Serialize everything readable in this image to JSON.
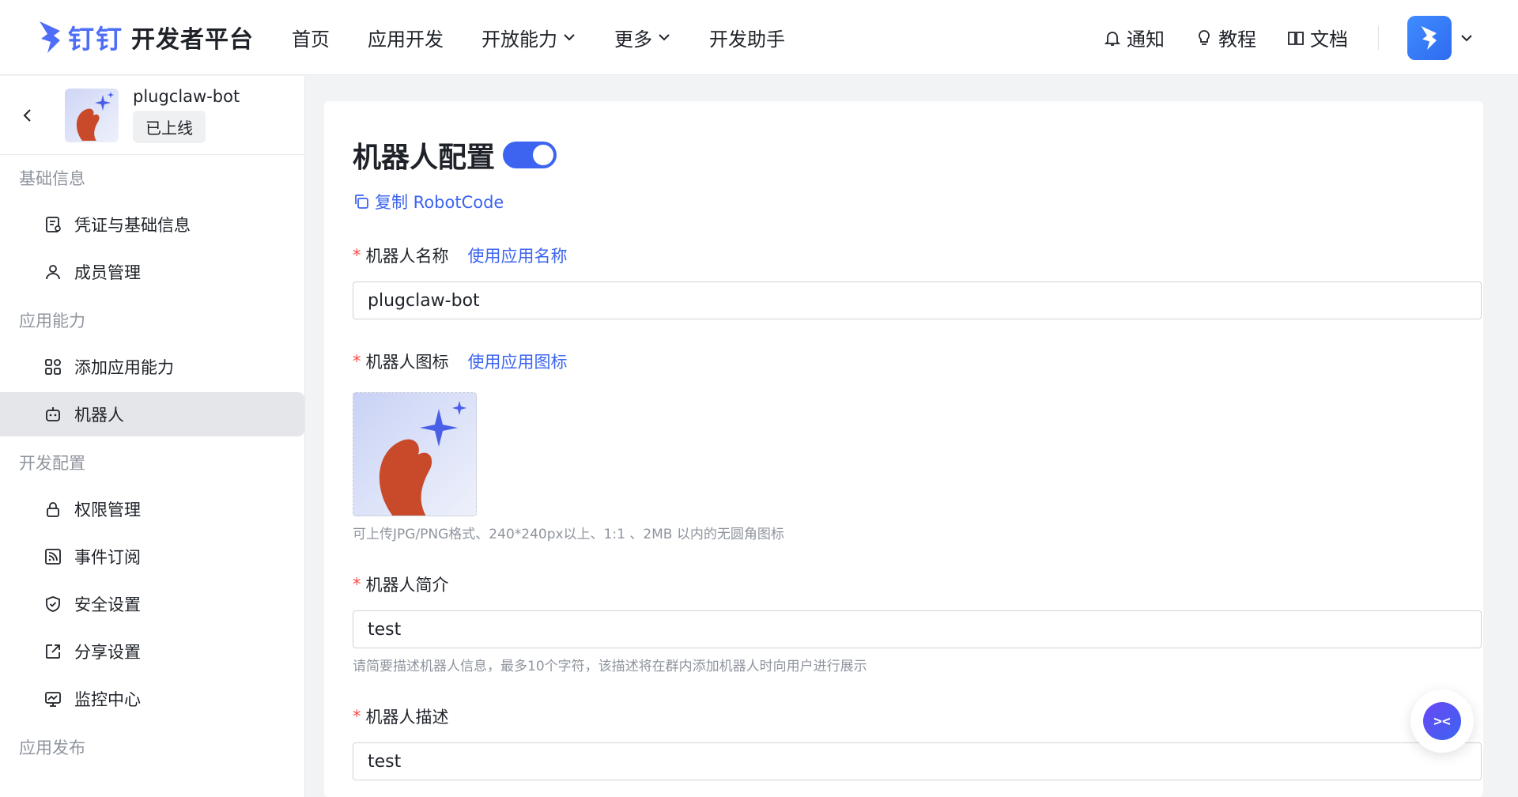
{
  "header": {
    "logo_brand": "钉钉",
    "logo_text": "开发者平台",
    "nav": [
      {
        "label": "首页",
        "has_dropdown": false
      },
      {
        "label": "应用开发",
        "has_dropdown": false
      },
      {
        "label": "开放能力",
        "has_dropdown": true
      },
      {
        "label": "更多",
        "has_dropdown": true
      },
      {
        "label": "开发助手",
        "has_dropdown": false
      }
    ],
    "tools": {
      "notify": "通知",
      "tutorial": "教程",
      "docs": "文档"
    }
  },
  "sidebar": {
    "app_name": "plugclaw-bot",
    "app_status": "已上线",
    "groups": [
      {
        "title": "基础信息",
        "items": [
          {
            "label": "凭证与基础信息",
            "icon": "credential-icon"
          },
          {
            "label": "成员管理",
            "icon": "user-icon"
          }
        ]
      },
      {
        "title": "应用能力",
        "items": [
          {
            "label": "添加应用能力",
            "icon": "grid-add-icon"
          },
          {
            "label": "机器人",
            "icon": "robot-icon",
            "active": true
          }
        ]
      },
      {
        "title": "开发配置",
        "items": [
          {
            "label": "权限管理",
            "icon": "lock-icon"
          },
          {
            "label": "事件订阅",
            "icon": "rss-icon"
          },
          {
            "label": "安全设置",
            "icon": "shield-icon"
          },
          {
            "label": "分享设置",
            "icon": "share-icon"
          },
          {
            "label": "监控中心",
            "icon": "monitor-icon"
          }
        ]
      },
      {
        "title": "应用发布",
        "items": []
      }
    ]
  },
  "main": {
    "title": "机器人配置",
    "toggle_on": true,
    "copy_label": "复制 RobotCode",
    "name_field": {
      "label": "机器人名称",
      "link": "使用应用名称",
      "value": "plugclaw-bot"
    },
    "icon_field": {
      "label": "机器人图标",
      "link": "使用应用图标",
      "hint": "可上传JPG/PNG格式、240*240px以上、1:1 、2MB 以内的无圆角图标"
    },
    "intro_field": {
      "label": "机器人简介",
      "value": "test",
      "hint": "请简要描述机器人信息，最多10个字符，该描述将在群内添加机器人时向用户进行展示"
    },
    "desc_field": {
      "label": "机器人描述",
      "value": "test"
    }
  },
  "colors": {
    "accent": "#3c64f0",
    "required": "#f54a45",
    "muted": "#8f959e"
  }
}
